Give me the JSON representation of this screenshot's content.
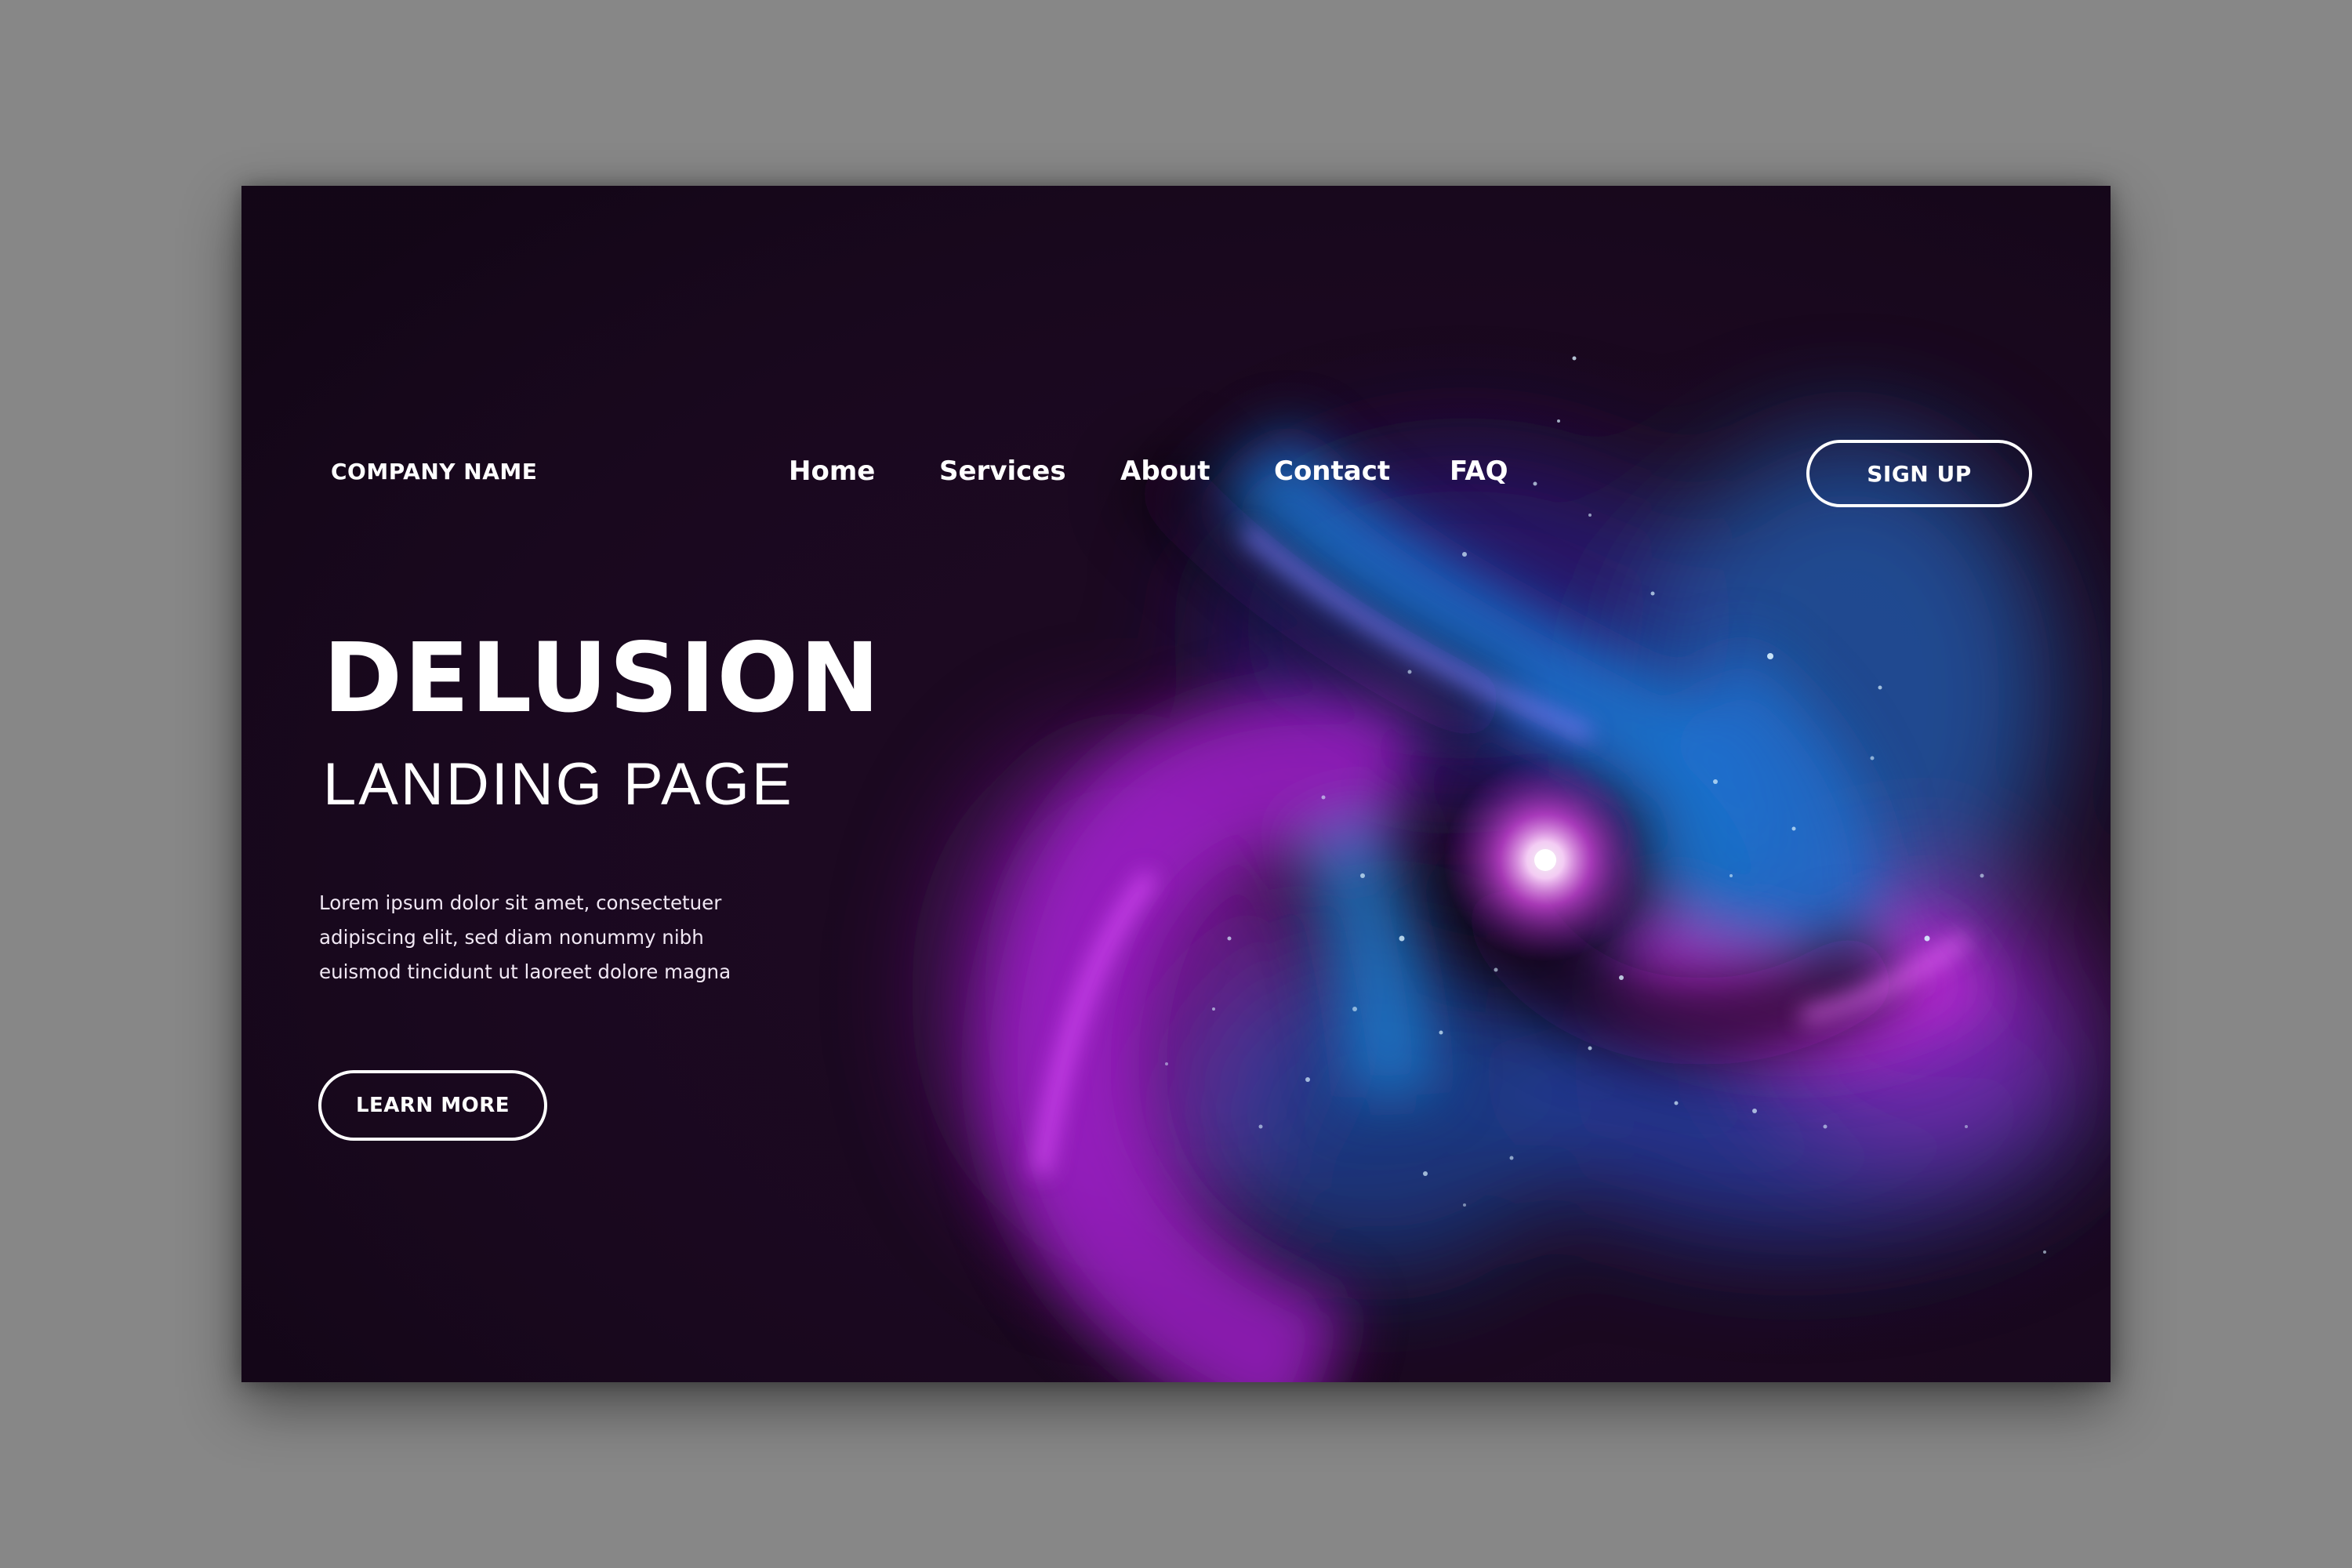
{
  "header": {
    "brand": "COMPANY NAME",
    "nav": [
      {
        "label": "Home"
      },
      {
        "label": "Services"
      },
      {
        "label": "About"
      },
      {
        "label": "Contact"
      },
      {
        "label": "FAQ"
      }
    ],
    "signup_label": "SIGN UP"
  },
  "hero": {
    "title": "DELUSION",
    "subtitle": "LANDING PAGE",
    "body_lines": [
      "Lorem ipsum dolor sit amet, consectetuer",
      "adipiscing elit, sed diam nonummy nibh",
      "euismod tincidunt ut laoreet dolore magna"
    ],
    "cta_label": "LEARN MORE"
  },
  "colors": {
    "background": "#160718",
    "outer_frame": "#878787",
    "accent_magenta": "#b21bd0",
    "accent_blue": "#1e7fd8",
    "text": "#ffffff"
  },
  "icons": []
}
